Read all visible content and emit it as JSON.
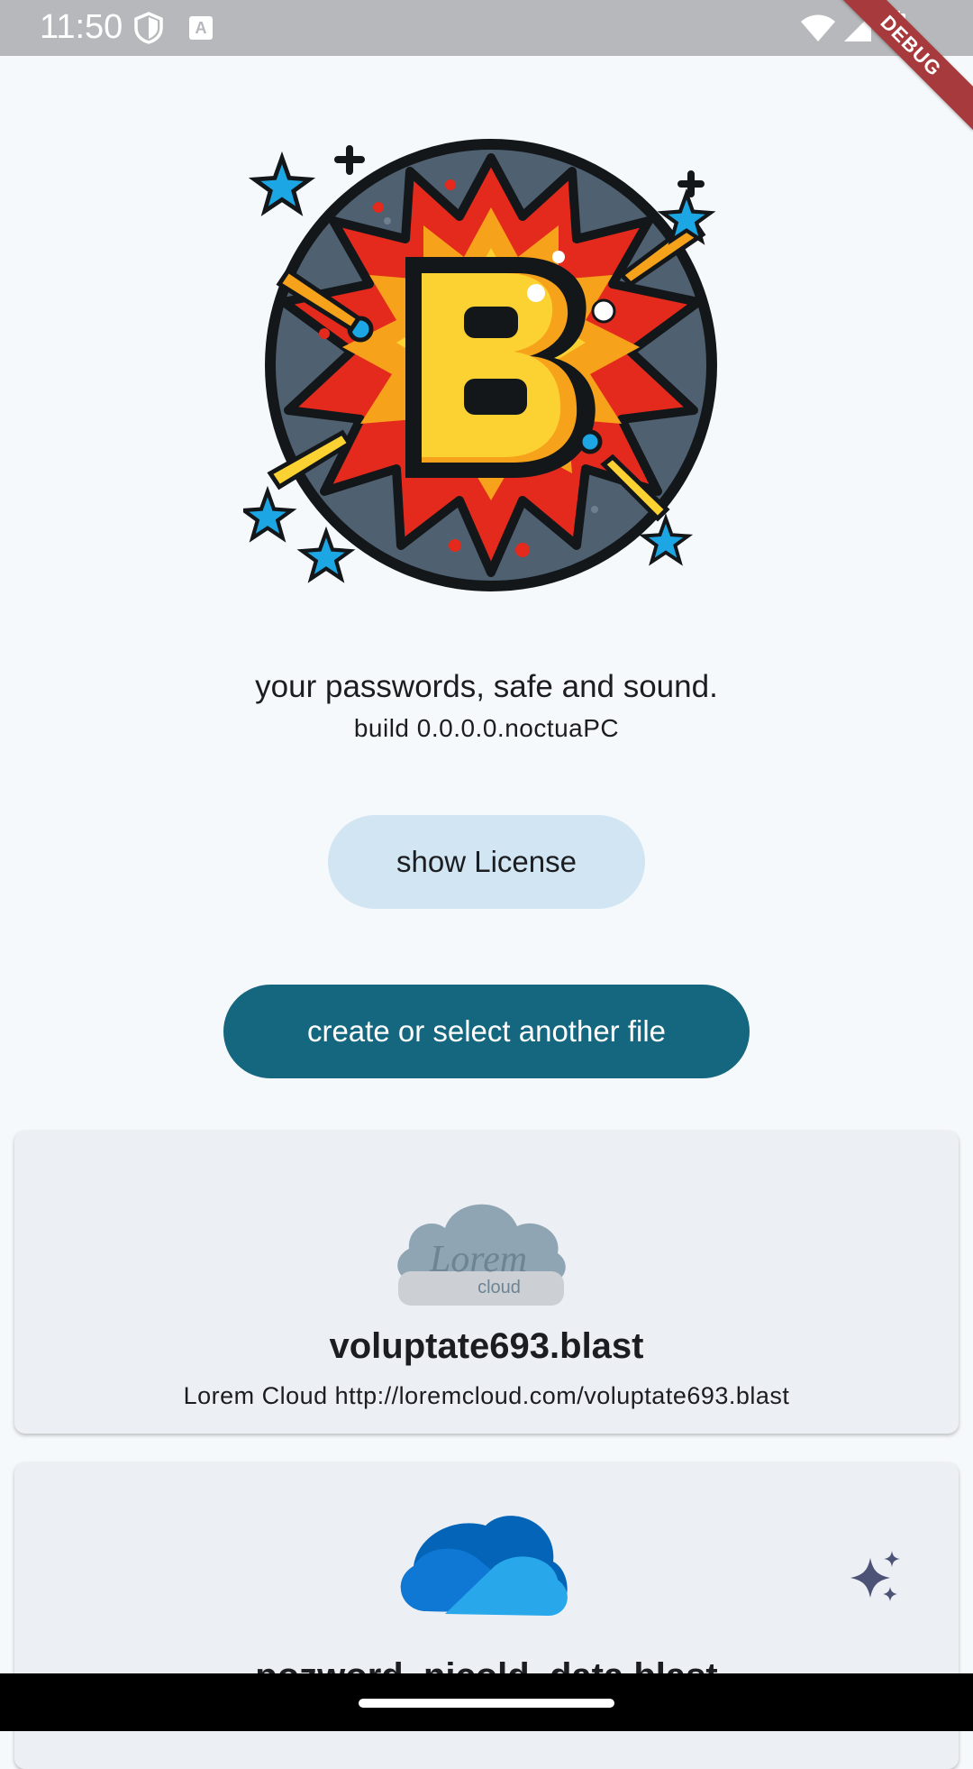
{
  "status_bar": {
    "time": "11:50",
    "keyboard_badge": "A",
    "debug_banner": "DEBUG"
  },
  "header": {
    "tagline": "your passwords, safe and sound.",
    "build": "build 0.0.0.0.noctuaPC"
  },
  "actions": {
    "show_license_label": "show License",
    "create_select_label": "create or select another file"
  },
  "files": [
    {
      "provider_icon": "lorem-cloud-icon",
      "logo_text": "Lorem",
      "logo_subtext": "cloud",
      "name": "voluptate693.blast",
      "detail": "Lorem Cloud http://loremcloud.com/voluptate693.blast"
    },
    {
      "provider_icon": "onedrive-cloud-icon",
      "name": "pozword_nicold_data.blast",
      "badge_icon": "sparkle-icon"
    }
  ],
  "colors": {
    "background": "#f6f9fc",
    "primary": "#156780",
    "tonal": "#d2e5f2",
    "card": "#eceff3",
    "status_bar": "#b6b8bb",
    "debug_ribbon": "#a63a3c"
  }
}
